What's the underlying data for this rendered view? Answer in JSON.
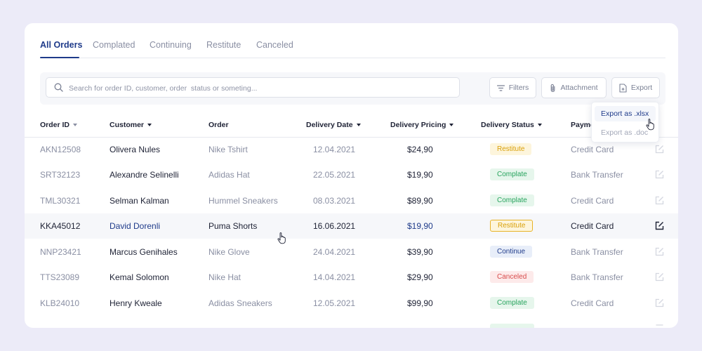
{
  "tabs": [
    {
      "label": "All Orders",
      "active": true
    },
    {
      "label": "Complated",
      "active": false
    },
    {
      "label": "Continuing",
      "active": false
    },
    {
      "label": "Restitute",
      "active": false
    },
    {
      "label": "Canceled",
      "active": false
    }
  ],
  "toolbar": {
    "search_placeholder": "Search for order ID, customer, order  status or someting...",
    "filters_label": "Filters",
    "attachment_label": "Attachment",
    "export_label": "Export"
  },
  "export_menu": {
    "items": [
      "Export as .xlsx",
      "Export as .doc"
    ]
  },
  "table": {
    "headers": {
      "order_id": "Order ID",
      "customer": "Customer",
      "order": "Order",
      "delivery_date": "Delivery Date",
      "delivery_pricing": "Delivery Pricing",
      "delivery_status": "Delivery Status",
      "payment": "Payme"
    },
    "rows": [
      {
        "id": "AKN12508",
        "customer": "Olivera Nules",
        "order": "Nike Tshirt",
        "date": "12.04.2021",
        "price": "$24,90",
        "status": "Restitute",
        "payment": "Credit Card"
      },
      {
        "id": "SRT32123",
        "customer": "Alexandre Selinelli",
        "order": "Adidas Hat",
        "date": "22.05.2021",
        "price": "$19,90",
        "status": "Complate",
        "payment": "Bank Transfer"
      },
      {
        "id": "TML30321",
        "customer": "Selman Kalman",
        "order": "Hummel Sneakers",
        "date": "08.03.2021",
        "price": "$89,90",
        "status": "Complate",
        "payment": "Credit Card"
      },
      {
        "id": "KKA45012",
        "customer": "David Dorenli",
        "order": "Puma Shorts",
        "date": "16.06.2021",
        "price": "$19,90",
        "status": "Restitute",
        "payment": "Credit Card"
      },
      {
        "id": "NNP23421",
        "customer": "Marcus Genihales",
        "order": "Nike Glove",
        "date": "24.04.2021",
        "price": "$39,90",
        "status": "Continue",
        "payment": "Bank Transfer"
      },
      {
        "id": "TTS23089",
        "customer": "Kemal Solomon",
        "order": "Nike Hat",
        "date": "14.04.2021",
        "price": "$29,90",
        "status": "Canceled",
        "payment": "Bank Transfer"
      },
      {
        "id": "KLB24010",
        "customer": "Henry Kweale",
        "order": "Adidas Sneakers",
        "date": "12.05.2021",
        "price": "$99,90",
        "status": "Complate",
        "payment": "Credit Card"
      }
    ]
  },
  "colors": {
    "accent": "#1f3b8a",
    "background": "#ecebf8",
    "restitute": "#d9a00a",
    "complate": "#27a35d",
    "continue": "#1f3b8a",
    "canceled": "#d84b4b"
  }
}
